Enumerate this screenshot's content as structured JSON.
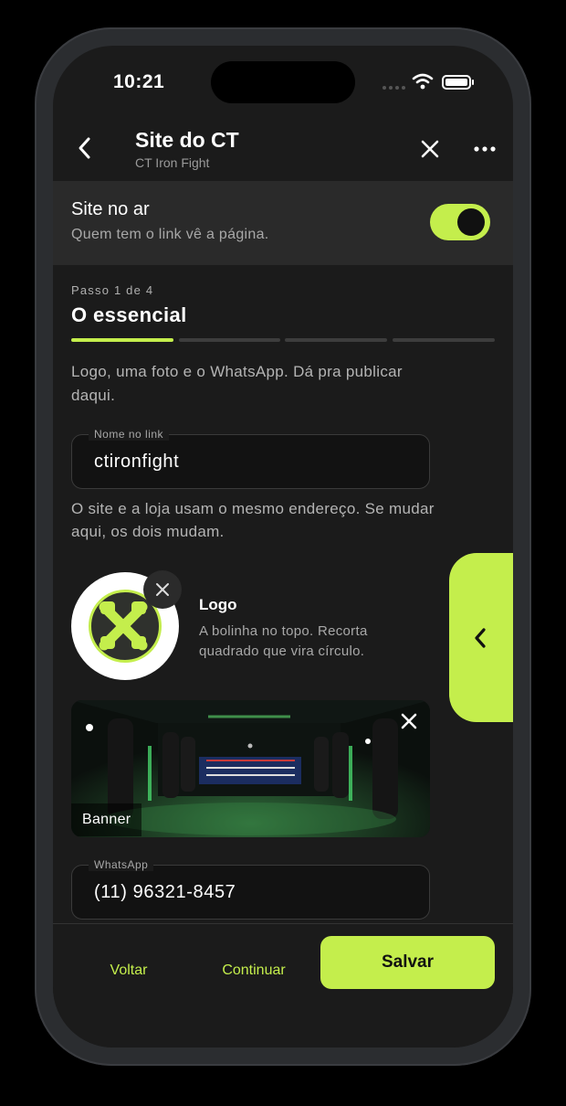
{
  "status_bar": {
    "time": "10:21"
  },
  "header": {
    "title": "Site do CT",
    "subtitle": "CT Iron Fight"
  },
  "online": {
    "title": "Site no ar",
    "description": "Quem tem o link vê a página.",
    "enabled": true
  },
  "step": {
    "label": "Passo 1 de 4",
    "title": "O essencial",
    "current": 1,
    "total": 4
  },
  "intro": "Logo, uma foto e o WhatsApp. Dá pra publicar daqui.",
  "link_field": {
    "label": "Nome no link",
    "value": "ctironfight"
  },
  "helper": "O site e a loja usam o mesmo endereço. Se mudar aqui, os dois mudam.",
  "logo": {
    "title": "Logo",
    "description": "A bolinha no topo. Recorta quadrado que vira círculo."
  },
  "banner": {
    "label": "Banner"
  },
  "whatsapp_field": {
    "label": "WhatsApp",
    "value": "(11) 96321-8457"
  },
  "actions": {
    "back": "Voltar",
    "continue": "Continuar",
    "save": "Salvar"
  },
  "colors": {
    "accent": "#c4ee4c",
    "background": "#1b1b1b",
    "surface": "#2a2a2a"
  }
}
